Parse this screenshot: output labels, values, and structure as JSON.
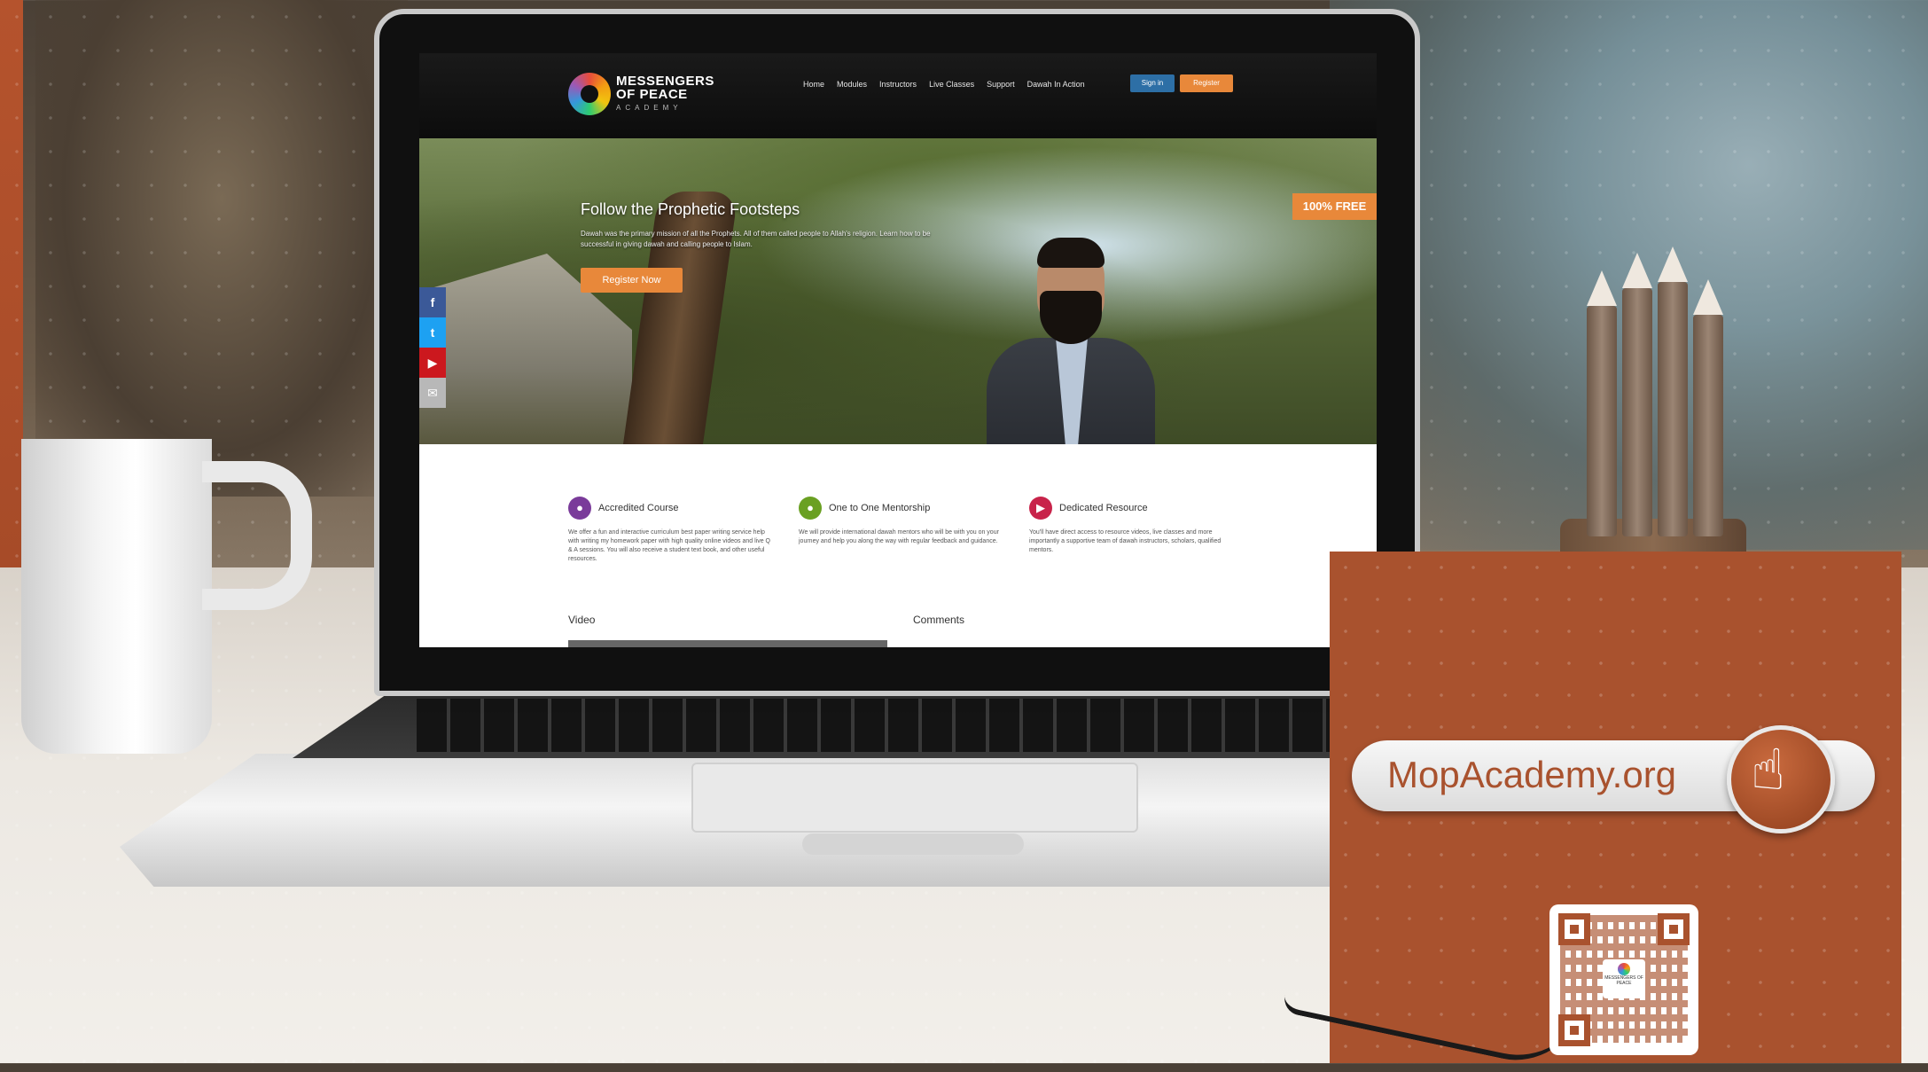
{
  "website": {
    "logo": {
      "line1": "MESSENGERS",
      "line2": "OF PEACE",
      "line3": "ACADEMY"
    },
    "nav": {
      "links": [
        "Home",
        "Modules",
        "Instructors",
        "Live Classes",
        "Support",
        "Dawah In Action"
      ],
      "signin_label": "Sign in",
      "register_label": "Register"
    },
    "hero": {
      "title": "Follow the Prophetic Footsteps",
      "text": "Dawah was the primary mission of all the Prophets. All of them called people to Allah's religion. Learn how to be successful in giving dawah and calling people to Islam.",
      "button_label": "Register Now",
      "badge": "100% FREE"
    },
    "social": [
      {
        "name": "facebook",
        "glyph": "f"
      },
      {
        "name": "twitter",
        "glyph": "t"
      },
      {
        "name": "youtube",
        "glyph": "▶"
      },
      {
        "name": "email",
        "glyph": "✉"
      }
    ],
    "features": [
      {
        "title": "Accredited Course",
        "icon": "person-icon",
        "glyph": "●",
        "color": "#7a3b9a",
        "text": "We offer a fun and interactive curriculum best paper writing service help with writing my homework paper with high quality online videos and live Q & A sessions. You will also receive a student text book, and other useful resources."
      },
      {
        "title": "One to One Mentorship",
        "icon": "chat-icon",
        "glyph": "●",
        "color": "#6aa022",
        "text": "We will provide international dawah mentors who will be with you on your journey and help you along the way with regular feedback and guidance."
      },
      {
        "title": "Dedicated Resource",
        "icon": "play-icon",
        "glyph": "▶",
        "color": "#c8234a",
        "text": "You'll have direct access to resource videos, live classes and more importantly a supportive team of dawah instructors, scholars, qualified mentors."
      }
    ],
    "sections": {
      "video": "Video",
      "comments": "Comments"
    }
  },
  "promo": {
    "url": "MopAcademy.org",
    "accent_color": "#a9522e",
    "qr_label": "MESSENGERS OF PEACE"
  }
}
